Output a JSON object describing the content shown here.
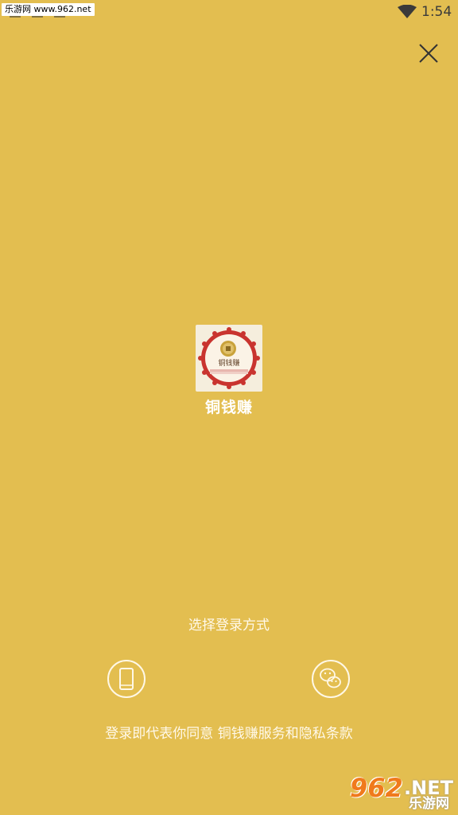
{
  "status_bar": {
    "watermark": "乐游网 www.962.net",
    "time": "1:54"
  },
  "app": {
    "name": "铜钱赚",
    "logo_text": "铜钱赚"
  },
  "login": {
    "title": "选择登录方式",
    "options": [
      {
        "name": "phone",
        "icon": "phone-icon"
      },
      {
        "name": "wechat",
        "icon": "wechat-icon"
      }
    ],
    "agreement": "登录即代表你同意 铜钱赚服务和隐私条款"
  },
  "watermark_bottom": {
    "number": "962",
    "net": ".NET",
    "site": "乐游网"
  },
  "colors": {
    "background": "#E3BE50",
    "text": "#FFFFFF",
    "logo_red": "#C9342F",
    "logo_gold": "#C9A23A"
  }
}
